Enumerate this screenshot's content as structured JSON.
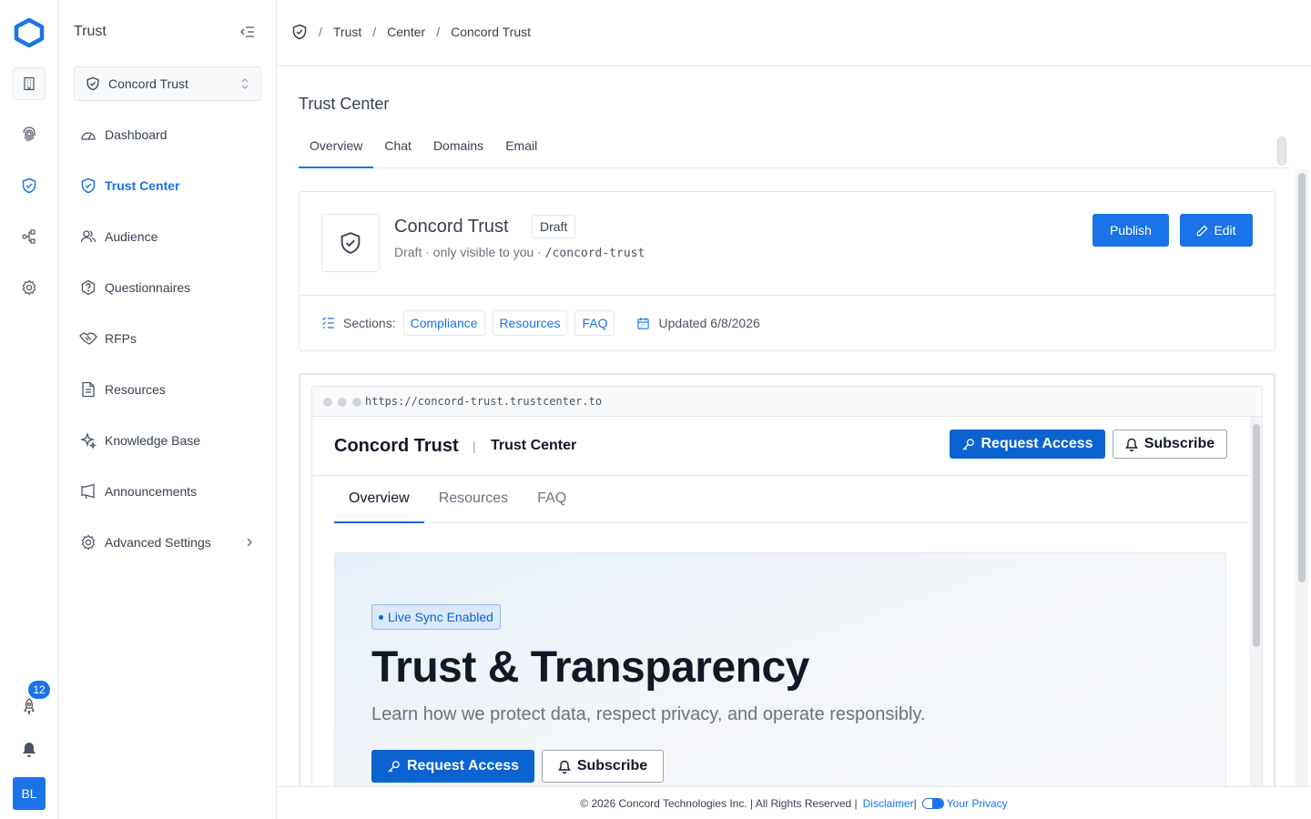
{
  "sidebar": {
    "title": "Trust",
    "workspace": "Concord Trust",
    "items": [
      {
        "label": "Dashboard",
        "icon": "gauge-icon"
      },
      {
        "label": "Trust Center",
        "icon": "shield-check-icon",
        "active": true
      },
      {
        "label": "Audience",
        "icon": "users-icon"
      },
      {
        "label": "Questionnaires",
        "icon": "question-icon"
      },
      {
        "label": "RFPs",
        "icon": "handshake-icon"
      },
      {
        "label": "Resources",
        "icon": "document-icon"
      },
      {
        "label": "Knowledge Base",
        "icon": "sparkle-icon"
      },
      {
        "label": "Announcements",
        "icon": "megaphone-icon"
      },
      {
        "label": "Advanced Settings",
        "icon": "gear-icon"
      }
    ]
  },
  "rail": {
    "notification_count": "12",
    "avatar_initials": "BL"
  },
  "breadcrumb": [
    "Trust",
    "Center",
    "Concord Trust"
  ],
  "page": {
    "title": "Trust Center",
    "tabs": [
      "Overview",
      "Chat",
      "Domains",
      "Email"
    ],
    "active_tab": "Overview"
  },
  "card": {
    "name": "Concord Trust",
    "status": "Draft",
    "subtitle": "Draft · only visible to you · ",
    "slug": "/concord-trust",
    "publish_label": "Publish",
    "edit_label": "Edit",
    "sections_label": "Sections:",
    "sections": [
      "Compliance",
      "Resources",
      "FAQ"
    ],
    "updated": "Updated 6/8/2026"
  },
  "preview": {
    "url": "https://concord-trust.trustcenter.to",
    "brand": "Concord Trust",
    "center_label": "Trust Center",
    "request_access": "Request Access",
    "subscribe": "Subscribe",
    "tabs": [
      "Overview",
      "Resources",
      "FAQ"
    ],
    "live_badge": "Live Sync Enabled",
    "hero_title": "Trust & Transparency",
    "hero_subtitle": "Learn how we protect data, respect privacy, and operate responsibly."
  },
  "footer": {
    "copyright": "© 2026 Concord Technologies Inc. | All Rights Reserved |",
    "disclaimer": "Disclaimer",
    "privacy": "Your Privacy"
  },
  "colors": {
    "accent": "#1a73e8",
    "preview_accent": "#0b63d1"
  }
}
